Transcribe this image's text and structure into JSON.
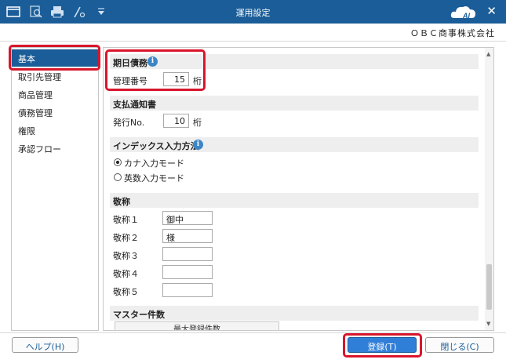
{
  "window": {
    "title": "運用設定",
    "company": "ＯＢＣ商事株式会社",
    "close_symbol": "✕",
    "logo_text": "AI",
    "toolbar_icons": [
      "window-icon",
      "search-icon",
      "print-icon",
      "tool-icon",
      "filter-icon"
    ]
  },
  "sidebar": {
    "items": [
      {
        "label": "基本",
        "active": true
      },
      {
        "label": "取引先管理"
      },
      {
        "label": "商品管理"
      },
      {
        "label": "債務管理"
      },
      {
        "label": "権限"
      },
      {
        "label": "承認フロー"
      }
    ]
  },
  "sections": {
    "kijitsu": {
      "title": "期日債務",
      "field_label": "管理番号",
      "value": "15",
      "unit": "桁"
    },
    "shiharai": {
      "title": "支払通知書",
      "field_label": "発行No.",
      "value": "10",
      "unit": "桁"
    },
    "index": {
      "title": "インデックス入力方法",
      "options": [
        "カナ入力モード",
        "英数入力モード"
      ],
      "selected": 0
    },
    "keisho": {
      "title": "敬称",
      "rows": [
        {
          "label": "敬称１",
          "value": "御中"
        },
        {
          "label": "敬称２",
          "value": "様"
        },
        {
          "label": "敬称３",
          "value": ""
        },
        {
          "label": "敬称４",
          "value": ""
        },
        {
          "label": "敬称５",
          "value": ""
        }
      ]
    },
    "master": {
      "title": "マスター件数",
      "column_header": "最大登録件数"
    }
  },
  "buttons": {
    "help": "ヘルプ(H)",
    "save": "登録(T)",
    "close": "閉じる(C)"
  },
  "colors": {
    "titlebar": "#1b5d98",
    "accent": "#2f7ed8",
    "highlight": "#d8162c"
  }
}
